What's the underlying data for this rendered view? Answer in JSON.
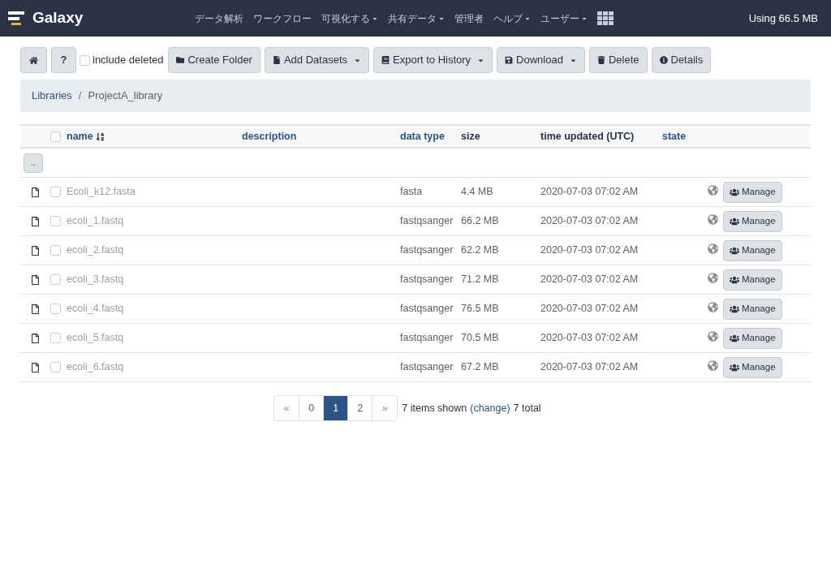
{
  "brand": {
    "name": "Galaxy"
  },
  "nav": [
    {
      "label": "データ解析",
      "dropdown": false
    },
    {
      "label": "ワークフロー",
      "dropdown": false
    },
    {
      "label": "可視化する",
      "dropdown": true
    },
    {
      "label": "共有データ",
      "dropdown": true
    },
    {
      "label": "管理者",
      "dropdown": false
    },
    {
      "label": "ヘルプ",
      "dropdown": true
    },
    {
      "label": "ユーザー",
      "dropdown": true
    }
  ],
  "quota": "Using 66.5 MB",
  "toolbar": {
    "help": "?",
    "include_deleted": {
      "label": "include deleted",
      "checked": false
    },
    "buttons": [
      {
        "kind": "folder",
        "label": "Create Folder",
        "dropdown": false
      },
      {
        "kind": "file",
        "label": "Add Datasets",
        "dropdown": true
      },
      {
        "kind": "book",
        "label": "Export to History",
        "dropdown": true
      },
      {
        "kind": "save",
        "label": "Download",
        "dropdown": true
      },
      {
        "kind": "trash",
        "label": "Delete",
        "dropdown": false
      },
      {
        "kind": "info",
        "label": "Details",
        "dropdown": false
      }
    ]
  },
  "breadcrumb": {
    "separator": "/",
    "items": [
      {
        "label": "Libraries",
        "link": true
      },
      {
        "label": "ProjectA_library",
        "link": false
      }
    ]
  },
  "table": {
    "select_all": {
      "checked": false
    },
    "columns": [
      {
        "label": "name",
        "sortable": true,
        "sorted": true
      },
      {
        "label": "description",
        "sortable": true,
        "sorted": false
      },
      {
        "label": "data type",
        "sortable": true,
        "sorted": false
      },
      {
        "label": "size",
        "sortable": false,
        "sorted": false
      },
      {
        "label": "time updated (UTC)",
        "sortable": false,
        "sorted": false
      },
      {
        "label": "state",
        "sortable": true,
        "sorted": false
      }
    ],
    "parent_button": "..",
    "rows": [
      {
        "name": "Ecoli_k12.fasta",
        "data_type": "fasta",
        "size": "4.4 MB",
        "time": "2020-07-03 07:02 AM",
        "checked": false,
        "action": "Manage"
      },
      {
        "name": "ecoli_1.fastq",
        "data_type": "fastqsanger",
        "size": "66.2 MB",
        "time": "2020-07-03 07:02 AM",
        "checked": false,
        "action": "Manage"
      },
      {
        "name": "ecoli_2.fastq",
        "data_type": "fastqsanger",
        "size": "62.2 MB",
        "time": "2020-07-03 07:02 AM",
        "checked": false,
        "action": "Manage"
      },
      {
        "name": "ecoli_3.fastq",
        "data_type": "fastqsanger",
        "size": "71.2 MB",
        "time": "2020-07-03 07:02 AM",
        "checked": false,
        "action": "Manage"
      },
      {
        "name": "ecoli_4.fastq",
        "data_type": "fastqsanger",
        "size": "76.5 MB",
        "time": "2020-07-03 07:02 AM",
        "checked": false,
        "action": "Manage"
      },
      {
        "name": "ecoli_5.fastq",
        "data_type": "fastqsanger",
        "size": "70.5 MB",
        "time": "2020-07-03 07:02 AM",
        "checked": false,
        "action": "Manage"
      },
      {
        "name": "ecoli_6.fastq",
        "data_type": "fastqsanger",
        "size": "67.2 MB",
        "time": "2020-07-03 07:02 AM",
        "checked": false,
        "action": "Manage"
      }
    ]
  },
  "pagination": {
    "first": "«",
    "pages": [
      {
        "label": "0",
        "selected": false
      },
      {
        "label": "1",
        "selected": true
      },
      {
        "label": "2",
        "selected": false
      }
    ],
    "last": "»",
    "shown": "7 items shown",
    "change": "(change)",
    "total": "7 total"
  }
}
